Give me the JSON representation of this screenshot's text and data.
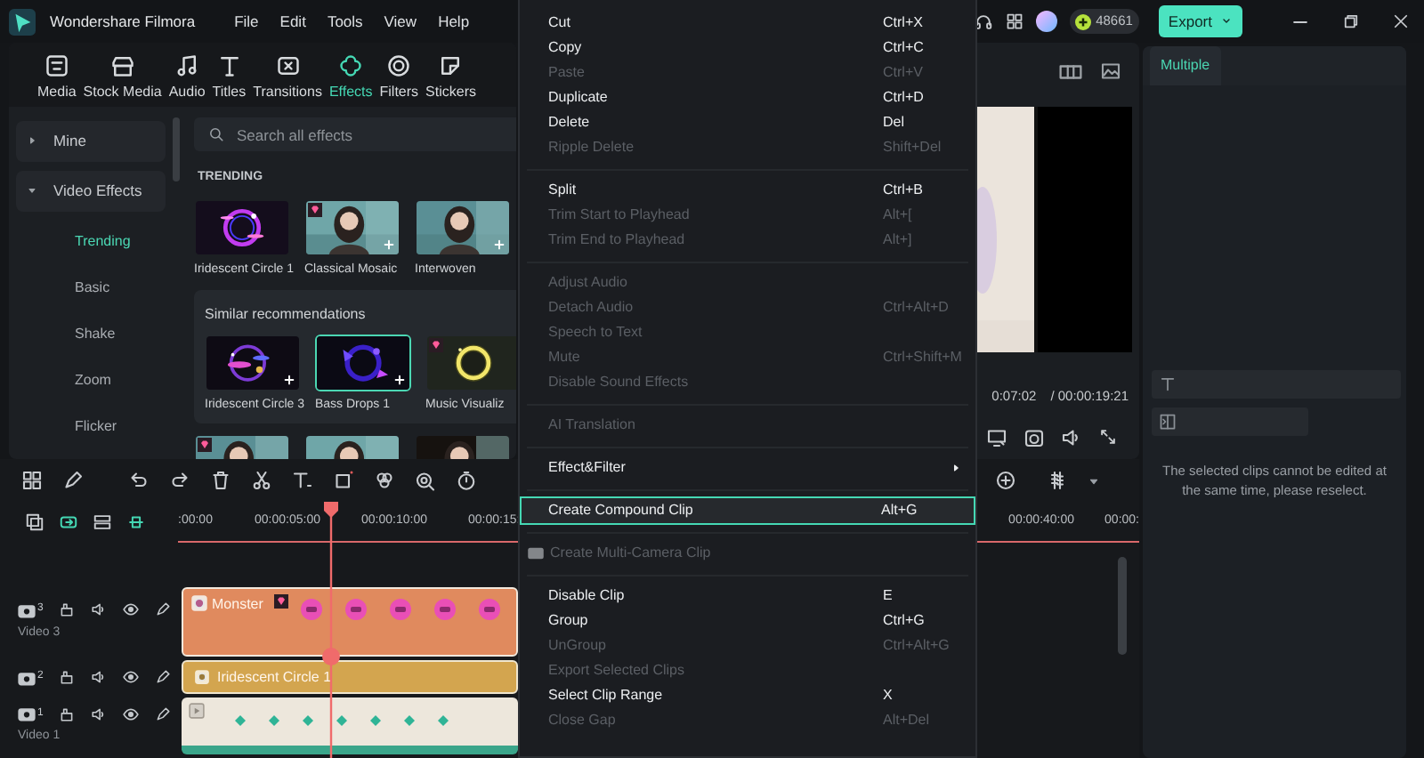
{
  "app": {
    "title": "Wondershare Filmora",
    "menus": [
      "File",
      "Edit",
      "Tools",
      "View",
      "Help"
    ],
    "credits": "48661",
    "export_button": "Export"
  },
  "library_tabs": [
    {
      "label": "Media",
      "selected": false
    },
    {
      "label": "Stock Media",
      "selected": false
    },
    {
      "label": "Audio",
      "selected": false
    },
    {
      "label": "Titles",
      "selected": false
    },
    {
      "label": "Transitions",
      "selected": false
    },
    {
      "label": "Effects",
      "selected": true
    },
    {
      "label": "Filters",
      "selected": false
    },
    {
      "label": "Stickers",
      "selected": false
    }
  ],
  "sidebar": [
    {
      "label": "Mine",
      "expanded": false
    },
    {
      "label": "Video Effects",
      "expanded": true,
      "children": [
        {
          "label": "Trending",
          "selected": true
        },
        {
          "label": "Basic",
          "selected": false
        },
        {
          "label": "Shake",
          "selected": false
        },
        {
          "label": "Zoom",
          "selected": false
        },
        {
          "label": "Flicker",
          "selected": false
        }
      ]
    }
  ],
  "search": {
    "placeholder": "Search all effects"
  },
  "trending": {
    "heading": "TRENDING",
    "items": [
      {
        "name": "Iridescent Circle 1",
        "premium": false,
        "add": false
      },
      {
        "name": "Classical Mosaic",
        "premium": true,
        "add": true
      },
      {
        "name": "Interwoven",
        "premium": false,
        "add": true
      }
    ]
  },
  "similar": {
    "heading": "Similar recommendations",
    "items": [
      {
        "name": "Iridescent Circle 3",
        "premium": false,
        "add": true,
        "selected": false
      },
      {
        "name": "Bass Drops 1",
        "premium": false,
        "add": true,
        "selected": true
      },
      {
        "name": "Music Visualiz",
        "premium": true,
        "add": false,
        "selected": false
      }
    ]
  },
  "more_items": [
    {
      "premium": true
    },
    {
      "premium": false
    },
    {
      "premium": false
    }
  ],
  "player": {
    "current_time": "0:07:02",
    "total_time": "/ 00:00:19:21"
  },
  "timeline": {
    "ruler_start": [
      ":00:00",
      "00:00:05:00",
      "00:00:10:00",
      "00:00:15:"
    ],
    "ruler_end": [
      "00:00:40:00",
      "00:00:"
    ],
    "tracks": [
      {
        "number": "3",
        "name": "Video 3",
        "clip": {
          "kind": "sticker",
          "label": "Monster",
          "premium": true
        }
      },
      {
        "number": "2",
        "clip": {
          "kind": "effect",
          "label": "Iridescent Circle 1",
          "premium": false
        }
      },
      {
        "number": "1",
        "name": "Video 1",
        "clip": {
          "kind": "video",
          "premium": false
        }
      }
    ]
  },
  "context_menu": [
    {
      "kind": "item",
      "label": "Cut",
      "shortcut": "Ctrl+X",
      "disabled": false,
      "highlighted": false
    },
    {
      "kind": "item",
      "label": "Copy",
      "shortcut": "Ctrl+C",
      "disabled": false,
      "highlighted": false
    },
    {
      "kind": "item",
      "label": "Paste",
      "shortcut": "Ctrl+V",
      "disabled": true,
      "highlighted": false
    },
    {
      "kind": "item",
      "label": "Duplicate",
      "shortcut": "Ctrl+D",
      "disabled": false,
      "highlighted": false
    },
    {
      "kind": "item",
      "label": "Delete",
      "shortcut": "Del",
      "disabled": false,
      "highlighted": false
    },
    {
      "kind": "item",
      "label": "Ripple Delete",
      "shortcut": "Shift+Del",
      "disabled": true,
      "highlighted": false
    },
    {
      "kind": "separator"
    },
    {
      "kind": "item",
      "label": "Split",
      "shortcut": "Ctrl+B",
      "disabled": false,
      "highlighted": false
    },
    {
      "kind": "item",
      "label": "Trim Start to Playhead",
      "shortcut": "Alt+[",
      "disabled": true,
      "highlighted": false
    },
    {
      "kind": "item",
      "label": "Trim End to Playhead",
      "shortcut": "Alt+]",
      "disabled": true,
      "highlighted": false
    },
    {
      "kind": "separator"
    },
    {
      "kind": "item",
      "label": "Adjust Audio",
      "disabled": true,
      "highlighted": false
    },
    {
      "kind": "item",
      "label": "Detach Audio",
      "shortcut": "Ctrl+Alt+D",
      "disabled": true,
      "highlighted": false
    },
    {
      "kind": "item",
      "label": "Speech to Text",
      "disabled": true,
      "highlighted": false
    },
    {
      "kind": "item",
      "label": "Mute",
      "shortcut": "Ctrl+Shift+M",
      "disabled": true,
      "highlighted": false
    },
    {
      "kind": "item",
      "label": "Disable Sound Effects",
      "disabled": true,
      "highlighted": false
    },
    {
      "kind": "separator"
    },
    {
      "kind": "item",
      "label": "AI Translation",
      "disabled": true,
      "highlighted": false
    },
    {
      "kind": "separator"
    },
    {
      "kind": "submenu",
      "label": "Effect&Filter",
      "disabled": false,
      "highlighted": false
    },
    {
      "kind": "separator"
    },
    {
      "kind": "item",
      "label": "Create Compound Clip",
      "shortcut": "Alt+G",
      "disabled": false,
      "highlighted": true
    },
    {
      "kind": "separator"
    },
    {
      "kind": "icon-item",
      "label": "Create Multi-Camera Clip",
      "disabled": true,
      "highlighted": false
    },
    {
      "kind": "separator"
    },
    {
      "kind": "item",
      "label": "Disable Clip",
      "shortcut": "E",
      "disabled": false,
      "highlighted": false
    },
    {
      "kind": "item",
      "label": "Group",
      "shortcut": "Ctrl+G",
      "disabled": false,
      "highlighted": false
    },
    {
      "kind": "item",
      "label": "UnGroup",
      "shortcut": "Ctrl+Alt+G",
      "disabled": true,
      "highlighted": false
    },
    {
      "kind": "item",
      "label": "Export Selected Clips",
      "disabled": true,
      "highlighted": false
    },
    {
      "kind": "item",
      "label": "Select Clip Range",
      "shortcut": "X",
      "disabled": false,
      "highlighted": false
    },
    {
      "kind": "item",
      "label": "Close Gap",
      "shortcut": "Alt+Del",
      "disabled": true,
      "highlighted": false
    }
  ],
  "properties": {
    "tabs": [
      {
        "label": "Multiple",
        "selected": true
      }
    ],
    "message": "The selected clips cannot be edited at the same time, please reselect."
  }
}
